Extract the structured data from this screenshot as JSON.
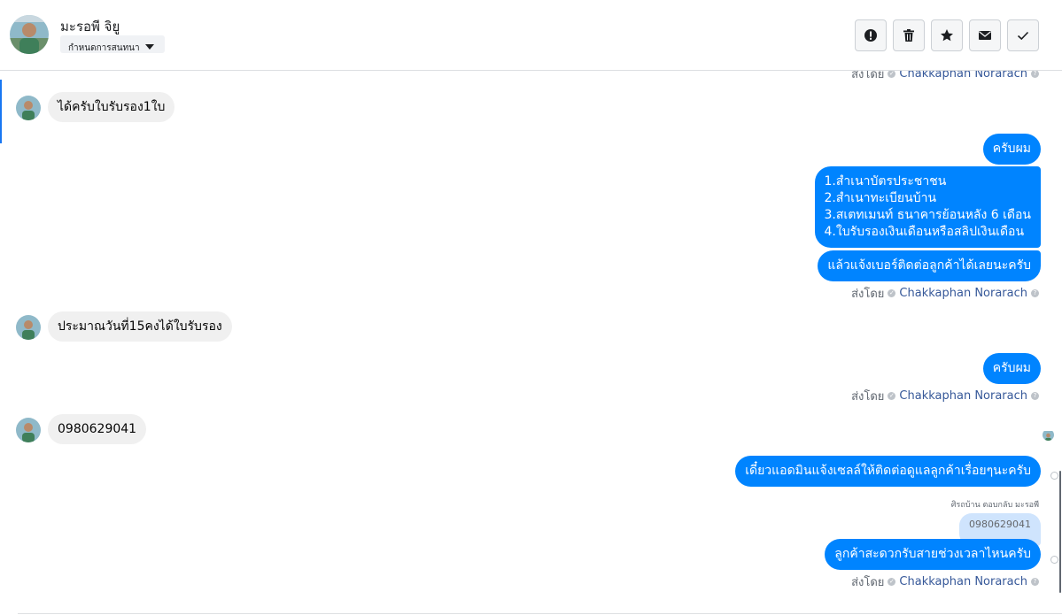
{
  "header": {
    "contact_name": "มะรอพี จิยู",
    "tag_label": "กำหนดการสนทนา",
    "actions": [
      {
        "name": "mark-spam-button",
        "icon": "alert-circle-icon"
      },
      {
        "name": "delete-button",
        "icon": "trash-icon"
      },
      {
        "name": "star-button",
        "icon": "star-icon"
      },
      {
        "name": "mark-unread-button",
        "icon": "envelope-icon"
      },
      {
        "name": "mark-done-button",
        "icon": "check-icon"
      }
    ]
  },
  "chat": {
    "sent_by_prefix": "ส่งโดย",
    "agent_name": "Chakkaphan Norarach",
    "messages": {
      "in1": "ได้ครับใบรับรอง1ใบ",
      "out1": "ครับผม",
      "out2_lines": [
        "1.สำเนาบัตรประชาชน",
        "2.สำเนาทะเบียนบ้าน",
        "3.สเตทเมนท์ ธนาคารย้อนหลัง 6 เดือน",
        "4.ใบรับรองเงินเดือนหรือสลิปเงินเดือน"
      ],
      "out3": "แล้วแจ้งเบอร์ติดต่อลูกค้าได้เลยนะครับ",
      "in2": "ประมาณวันที่15คงได้ใบรับรอง",
      "out4": "ครับผม",
      "in3": "0980629041",
      "out5": "เดี๋ยวแอดมินแจ้งเซลล์ให้ติดต่อดูแลลูกค้าเรื่อยๆนะครับ",
      "reply_label": "ศิรถบ้าน ตอบกลับ มะรอพี",
      "quoted": "0980629041",
      "out6": "ลูกค้าสะดวกรับสายช่วงเวลาไหนครับ"
    }
  },
  "colors": {
    "outgoing_bubble": "#0084ff",
    "incoming_bubble": "#f0f0f0",
    "agent_link": "#365899",
    "accent": "#1877f2"
  }
}
